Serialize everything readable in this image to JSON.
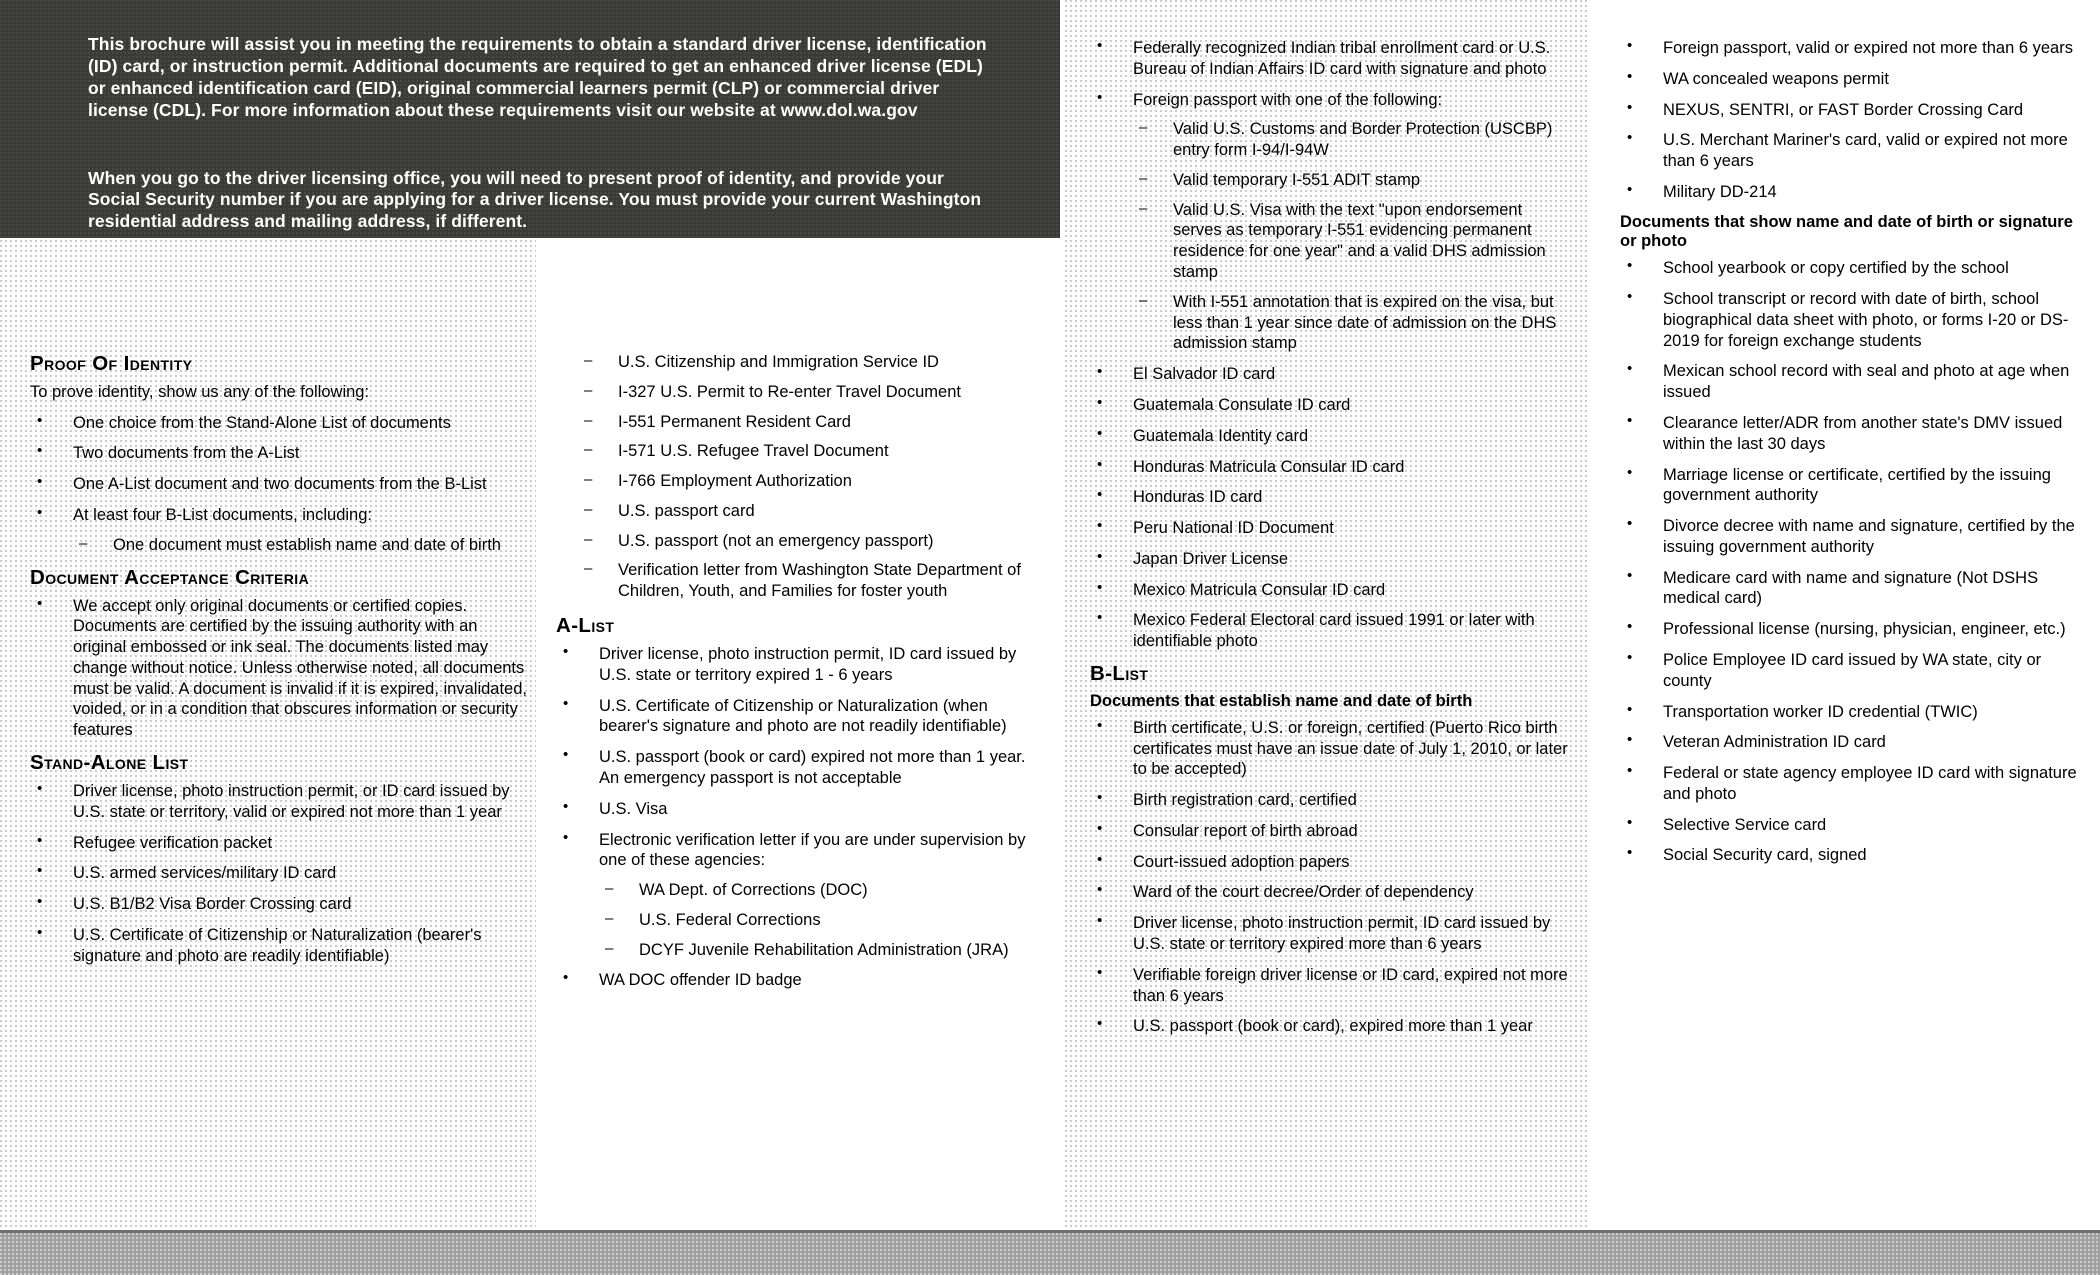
{
  "intro": {
    "paragraph1": "This brochure will assist you in meeting the requirements to obtain a standard driver license, identification (ID) card, or instruction permit. Additional documents are required to get an enhanced driver license (EDL) or enhanced identification card (EID), original commercial learners permit (CLP) or commercial driver license (CDL). For more information about these requirements visit our website at www.dol.wa.gov",
    "paragraph2": "When you go to the driver licensing office, you will need to present proof of identity, and provide your Social Security number if you are applying for a driver license. You must provide your current Washington residential address and mailing address, if different."
  },
  "proof_of_identity": {
    "heading": "Proof of identity",
    "lead": "To prove identity, show us any of the following:",
    "items": [
      "One choice from the Stand-Alone List of documents",
      "Two documents from the A-List",
      "One A-List document and two documents from the B-List",
      "At least four B-List documents, including:"
    ],
    "sub_items": [
      "One document must establish name and date of birth"
    ]
  },
  "document_acceptance": {
    "heading": "Document acceptance criteria",
    "items": [
      "We accept only original documents or certified copies. Documents are certified by the issuing authority with an original embossed or ink seal. The documents listed may change without notice. Unless otherwise noted, all documents must be valid. A document is invalid if it is expired, invalidated, voided, or in a condition that obscures information or security features"
    ]
  },
  "stand_alone_list": {
    "heading": "Stand-Alone List",
    "items": [
      "Driver license, photo instruction permit, or ID card issued by U.S. state or territory, valid or expired not more than 1 year",
      "Refugee verification packet",
      "U.S. armed services/military ID card",
      "U.S. B1/B2 Visa Border Crossing card",
      "U.S. Certificate of Citizenship or Naturalization (bearer's signature and photo are readily identifiable)"
    ],
    "continued_dashes": [
      "U.S. Citizenship and Immigration Service ID",
      "I-327 U.S. Permit to Re-enter Travel Document",
      "I-551 Permanent Resident Card",
      "I-571 U.S. Refugee Travel Document",
      "I-766 Employment Authorization",
      "U.S. passport card",
      "U.S. passport (not an emergency passport)",
      "Verification letter from Washington State Department of Children, Youth, and Families for foster youth"
    ]
  },
  "a_list": {
    "heading": "A-List",
    "items": [
      "Driver license, photo instruction permit, ID card issued by U.S. state or territory expired 1 - 6 years",
      "U.S. Certificate of Citizenship or Naturalization (when bearer's signature and photo are not readily identifiable)",
      "U.S. passport (book or card) expired not more than 1 year. An emergency passport is not acceptable",
      "U.S. Visa",
      "Electronic verification letter if you are under supervision by one of these agencies:"
    ],
    "agency_items": [
      "WA Dept. of Corrections (DOC)",
      "U.S. Federal Corrections",
      "DCYF Juvenile Rehabilitation Administration (JRA)"
    ],
    "final_item": "WA DOC offender ID badge",
    "continued_items": [
      "Federally recognized Indian tribal enrollment card or U.S. Bureau of Indian Affairs ID card with signature and photo",
      "Foreign passport with one of the following:"
    ],
    "foreign_passport_subitems": [
      "Valid U.S. Customs and Border Protection (USCBP) entry form I-94/I-94W",
      "Valid temporary I-551 ADIT stamp",
      "Valid U.S. Visa with the text \"upon endorsement serves as temporary I-551 evidencing permanent residence for one year\" and a valid DHS admission stamp",
      "With I-551 annotation that is expired on the visa, but less than 1 year since date of admission on the DHS admission stamp"
    ],
    "country_items": [
      "El Salvador ID card",
      "Guatemala Consulate ID card",
      "Guatemala Identity card",
      "Honduras Matricula Consular ID card",
      "Honduras ID card",
      "Peru National ID Document",
      "Japan Driver License",
      "Mexico Matricula Consular ID card",
      "Mexico Federal Electoral card issued 1991 or later with identifiable photo"
    ]
  },
  "b_list": {
    "heading": "B-List",
    "subheading_name_dob": "Documents that establish name and date of birth",
    "name_dob_items": [
      "Birth certificate, U.S. or foreign, certified (Puerto Rico birth certificates must have an issue date of July 1, 2010, or later to be accepted)",
      "Birth registration card, certified",
      "Consular report of birth abroad",
      "Court-issued adoption papers",
      "Ward of the court decree/Order of dependency",
      "Driver license, photo instruction permit, ID card issued by U.S. state or territory expired more than 6 years",
      "Verifiable foreign driver license or ID card, expired not more than 6 years",
      "U.S. passport (book or card), expired more than 1 year",
      "Foreign passport, valid or expired not more than 6 years",
      "WA concealed weapons permit",
      "NEXUS, SENTRI, or FAST Border Crossing Card",
      "U.S. Merchant Mariner's card, valid or expired not more than 6 years",
      "Military DD-214"
    ],
    "subheading_name_dob_sig_photo": "Documents that show name and date of birth or signature or photo",
    "name_dob_sig_photo_items": [
      "School yearbook or copy certified by the school",
      "School transcript or record with date of birth, school biographical data sheet with photo, or forms I-20 or DS-2019 for foreign exchange students",
      "Mexican school record with seal and photo at age when issued",
      "Clearance letter/ADR from another state's DMV issued within the last 30 days",
      "Marriage license or certificate, certified by the issuing government authority",
      "Divorce decree with name and signature, certified by the issuing government authority",
      "Medicare card with name and signature (Not DSHS medical card)",
      "Professional license (nursing, physician, engineer, etc.)",
      "Police Employee ID card issued by WA state, city or county",
      "Transportation worker ID credential (TWIC)",
      "Veteran Administration ID card",
      "Federal or state agency employee ID card with signature and photo",
      "Selective Service card",
      "Social Security card, signed"
    ]
  },
  "colors": {
    "banner_background": "#3a3a38",
    "banner_text": "#ffffff",
    "body_text": "#000000",
    "page_background": "#ffffff",
    "bottom_strip": "#a0a0a0"
  }
}
